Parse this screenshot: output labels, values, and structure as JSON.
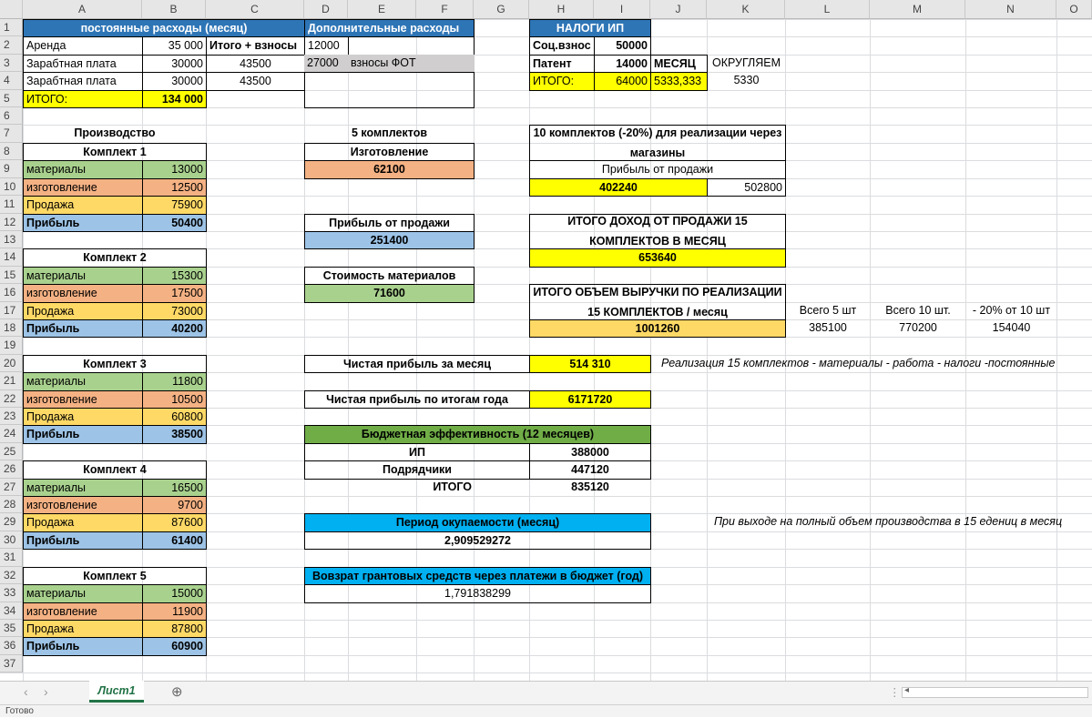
{
  "columns": [
    "A",
    "B",
    "C",
    "D",
    "E",
    "F",
    "G",
    "H",
    "I",
    "J",
    "K",
    "L",
    "M",
    "N",
    "O"
  ],
  "rows": [
    "1",
    "2",
    "3",
    "4",
    "5",
    "6",
    "7",
    "8",
    "9",
    "10",
    "11",
    "12",
    "13",
    "14",
    "15",
    "16",
    "17",
    "18",
    "19",
    "20",
    "21",
    "22",
    "23",
    "24",
    "25",
    "26",
    "27",
    "28",
    "29",
    "30",
    "31",
    "32",
    "33",
    "34",
    "35",
    "36",
    "37"
  ],
  "colors": {
    "blue": "#2e75b6",
    "sky": "#00b0f0",
    "green": "#a9d18e",
    "salmon": "#f4b183",
    "yellow": "#ffff00",
    "gold": "#ffd966",
    "lightblue": "#9dc3e6",
    "gray": "#d0cece",
    "darkgreen": "#70ad47"
  },
  "cells": {
    "A1": "постоянные расходы (месяц)",
    "A2": "Аренда",
    "B2": "35 000",
    "C2": "Итого + взносы",
    "A3": "Зарабтная плата",
    "B3": "30000",
    "C3": "43500",
    "A4": "Зарабтная плата",
    "B4": "30000",
    "C4": "43500",
    "A5": "ИТОГО:",
    "B5": "134 000",
    "D1": "Дополнительные расходы",
    "D2": "12000",
    "D3": "27000",
    "E3": "взносы ФОТ",
    "H1": "НАЛОГИ ИП",
    "H2": "Соц.взнос",
    "I2": "50000",
    "H3": "Патент",
    "I3": "14000",
    "J3": "МЕСЯЦ",
    "K3": "ОКРУГЛЯЕМ",
    "H4": "ИТОГО:",
    "I4": "64000",
    "J4": "5333,333",
    "K4": "5330",
    "A7": "Производство",
    "A8": "Комплект 1",
    "A9": "материалы",
    "B9": "13000",
    "A10": "изготовление",
    "B10": "12500",
    "A11": "Продажа",
    "B11": "75900",
    "A12": "Прибыль",
    "B12": "50400",
    "A14": "Комплект 2",
    "A15": "материалы",
    "B15": "15300",
    "A16": "изготовление",
    "B16": "17500",
    "A17": "Продажа",
    "B17": "73000",
    "A18": "Прибыль",
    "B18": "40200",
    "A20": "Комплект 3",
    "A21": "материалы",
    "B21": "11800",
    "A22": "изготовление",
    "B22": "10500",
    "A23": "Продажа",
    "B23": "60800",
    "A24": "Прибыль",
    "B24": "38500",
    "A26": "Комплект 4",
    "A27": "материалы",
    "B27": "16500",
    "A28": "изготовление",
    "B28": "9700",
    "A29": "Продажа",
    "B29": "87600",
    "A30": "Прибыль",
    "B30": "61400",
    "A32": "Комплект 5",
    "A33": "материалы",
    "B33": "15000",
    "A34": "изготовление",
    "B34": "11900",
    "A35": "Продажа",
    "B35": "87800",
    "A36": "Прибыль",
    "B36": "60900",
    "D7": "5 комплектов",
    "D8": "Изготовление",
    "D9": "62100",
    "D12": "Прибыль от продажи",
    "D13": "251400",
    "D15": "Стоимость материалов",
    "D16": "71600",
    "H7a": "10 комплектов (-20%) для реализации через",
    "H7b": "магазины",
    "H9": "Прибыль от продажи",
    "H10": "402240",
    "K10": "502800",
    "H12a": "ИТОГО ДОХОД ОТ ПРОДАЖИ 15",
    "H12b": "КОМПЛЕКТОВ В МЕСЯЦ",
    "H14": "653640",
    "H16a": "ИТОГО ОБЪЕМ ВЫРУЧКИ ПО РЕАЛИЗАЦИИ",
    "H16b": "15 КОМПЛЕКТОВ / месяц",
    "H18": "1001260",
    "L17": "Всего 5 шт",
    "M17": "Всего 10 шт.",
    "N17": "- 20% от 10 шт",
    "L18": "385100",
    "M18": "770200",
    "N18": "154040",
    "D20": "Чистая прибыль за месяц",
    "H20": "514 310",
    "J20": "Реализация 15 комплектов - материалы - работа - налоги -постоянные",
    "D22": "Чистая прибыль по итогам года",
    "H22": "6171720",
    "D24": "Бюджетная эффективность (12 месяцев)",
    "D25": "ИП",
    "H25": "388000",
    "D26": "Подрядчики",
    "H26": "447120",
    "E27": "ИТОГО",
    "H27": "835120",
    "D29": "Период окупаемости (месяц)",
    "D30": "2,909529272",
    "K29": "При выходе на полный объем производства в 15 едениц в месяц",
    "D32": "Вовзрат грантовых средств через платежи в бюджет (год)",
    "D33": "1,791838299"
  },
  "tab": {
    "sheet": "Лист1",
    "add": "⊕",
    "nav_prev": "‹",
    "nav_next": "›"
  },
  "status": "Готово"
}
